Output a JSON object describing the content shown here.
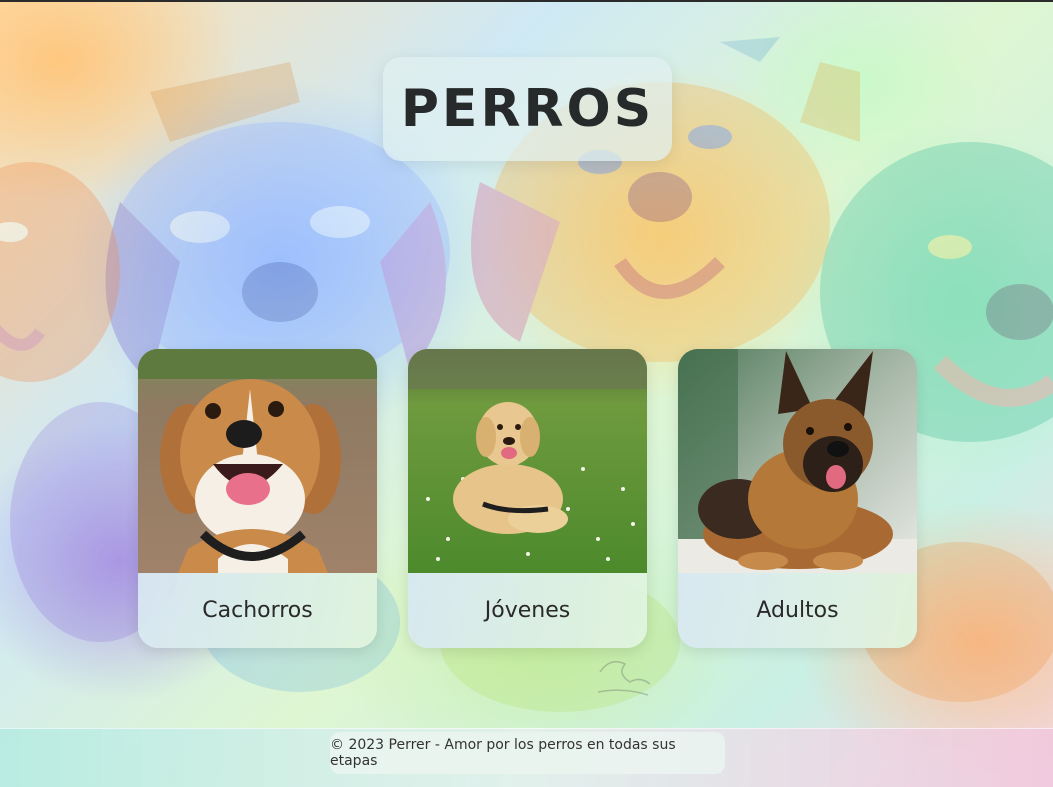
{
  "header": {
    "title": "PERROS"
  },
  "cards": [
    {
      "label": "Cachorros",
      "image_alt": "beagle-puppy-photo"
    },
    {
      "label": "Jóvenes",
      "image_alt": "golden-retriever-photo"
    },
    {
      "label": "Adultos",
      "image_alt": "german-shepherd-photo"
    }
  ],
  "footer": {
    "text": "© 2023 Perrer - Amor por los perros en todas sus etapas"
  },
  "colors": {
    "title_text": "#262a2b",
    "card_bg": "#dcf0e1",
    "page_border": "#2b2b2b"
  }
}
